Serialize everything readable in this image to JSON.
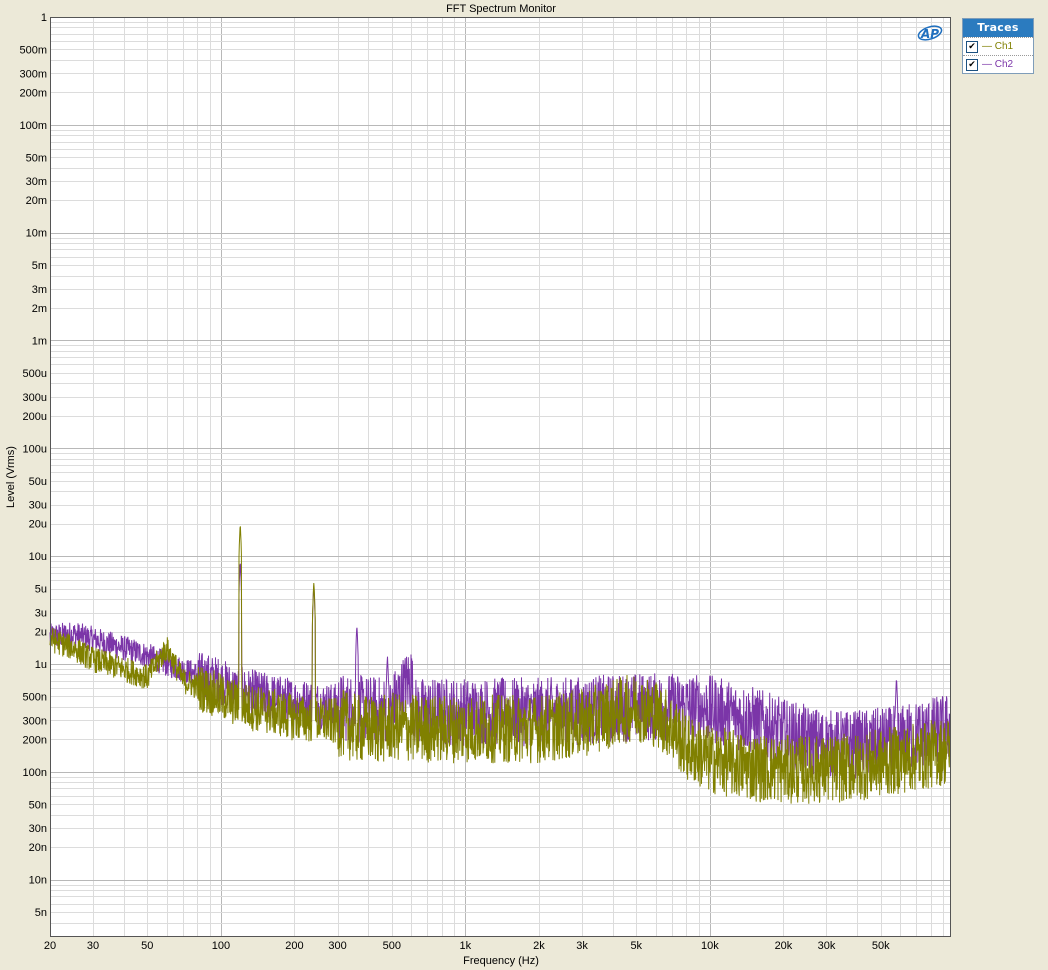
{
  "window": {
    "title": "FFT Spectrum Monitor"
  },
  "logo": {
    "text": "AP"
  },
  "traces_panel": {
    "header": "Traces",
    "items": [
      {
        "label": "— Ch1",
        "checked": true,
        "color": "#808000"
      },
      {
        "label": "— Ch2",
        "checked": true,
        "color": "#7b35a8"
      }
    ]
  },
  "chart_data": {
    "type": "line",
    "title": "FFT Spectrum Monitor",
    "xlabel": "Frequency (Hz)",
    "ylabel": "Level (Vrms)",
    "xscale": "log",
    "yscale": "log",
    "xlim": [
      20,
      96000
    ],
    "ylim": [
      3e-09,
      1
    ],
    "grid": true,
    "legend": "right panel",
    "x_ticks": [
      {
        "value": 20,
        "label": "20"
      },
      {
        "value": 30,
        "label": "30"
      },
      {
        "value": 50,
        "label": "50"
      },
      {
        "value": 100,
        "label": "100"
      },
      {
        "value": 200,
        "label": "200"
      },
      {
        "value": 300,
        "label": "300"
      },
      {
        "value": 500,
        "label": "500"
      },
      {
        "value": 1000,
        "label": "1k"
      },
      {
        "value": 2000,
        "label": "2k"
      },
      {
        "value": 3000,
        "label": "3k"
      },
      {
        "value": 5000,
        "label": "5k"
      },
      {
        "value": 10000,
        "label": "10k"
      },
      {
        "value": 20000,
        "label": "20k"
      },
      {
        "value": 30000,
        "label": "30k"
      },
      {
        "value": 50000,
        "label": "50k"
      }
    ],
    "y_ticks": [
      {
        "value": 1,
        "label": "1"
      },
      {
        "value": 0.5,
        "label": "500m"
      },
      {
        "value": 0.3,
        "label": "300m"
      },
      {
        "value": 0.2,
        "label": "200m"
      },
      {
        "value": 0.1,
        "label": "100m"
      },
      {
        "value": 0.05,
        "label": "50m"
      },
      {
        "value": 0.03,
        "label": "30m"
      },
      {
        "value": 0.02,
        "label": "20m"
      },
      {
        "value": 0.01,
        "label": "10m"
      },
      {
        "value": 0.005,
        "label": "5m"
      },
      {
        "value": 0.003,
        "label": "3m"
      },
      {
        "value": 0.002,
        "label": "2m"
      },
      {
        "value": 0.001,
        "label": "1m"
      },
      {
        "value": 0.0005,
        "label": "500u"
      },
      {
        "value": 0.0003,
        "label": "300u"
      },
      {
        "value": 0.0002,
        "label": "200u"
      },
      {
        "value": 0.0001,
        "label": "100u"
      },
      {
        "value": 5e-05,
        "label": "50u"
      },
      {
        "value": 3e-05,
        "label": "30u"
      },
      {
        "value": 2e-05,
        "label": "20u"
      },
      {
        "value": 1e-05,
        "label": "10u"
      },
      {
        "value": 5e-06,
        "label": "5u"
      },
      {
        "value": 3e-06,
        "label": "3u"
      },
      {
        "value": 2e-06,
        "label": "2u"
      },
      {
        "value": 1e-06,
        "label": "1u"
      },
      {
        "value": 5e-07,
        "label": "500n"
      },
      {
        "value": 3e-07,
        "label": "300n"
      },
      {
        "value": 2e-07,
        "label": "200n"
      },
      {
        "value": 1e-07,
        "label": "100n"
      },
      {
        "value": 5e-08,
        "label": "50n"
      },
      {
        "value": 3e-08,
        "label": "30n"
      },
      {
        "value": 2e-08,
        "label": "20n"
      },
      {
        "value": 1e-08,
        "label": "10n"
      },
      {
        "value": 5e-09,
        "label": "5n"
      }
    ],
    "series": [
      {
        "name": "Ch1",
        "color": "#808000",
        "points": [
          [
            20,
            1.7e-06
          ],
          [
            25,
            1.4e-06
          ],
          [
            30,
            1.1e-06
          ],
          [
            40,
            9e-07
          ],
          [
            50,
            7.5e-07
          ],
          [
            60,
            1.4e-06
          ],
          [
            70,
            7e-07
          ],
          [
            90,
            5.5e-07
          ],
          [
            110,
            4.5e-07
          ],
          [
            120,
            2e-05
          ],
          [
            130,
            4e-07
          ],
          [
            170,
            3.5e-07
          ],
          [
            200,
            3.2e-07
          ],
          [
            240,
            5.8e-06
          ],
          [
            250,
            3e-07
          ],
          [
            300,
            2.9e-07
          ],
          [
            360,
            2.5e-07
          ],
          [
            480,
            2.5e-07
          ],
          [
            500,
            2.6e-07
          ],
          [
            700,
            2.5e-07
          ],
          [
            1000,
            2.5e-07
          ],
          [
            2000,
            2.5e-07
          ],
          [
            3000,
            2.8e-07
          ],
          [
            4000,
            3.5e-07
          ],
          [
            5000,
            4e-07
          ],
          [
            6000,
            3.5e-07
          ],
          [
            7000,
            2.6e-07
          ],
          [
            8000,
            1.7e-07
          ],
          [
            10000,
            1.3e-07
          ],
          [
            15000,
            1.1e-07
          ],
          [
            20000,
            1.05e-07
          ],
          [
            30000,
            1.05e-07
          ],
          [
            40000,
            1.1e-07
          ],
          [
            50000,
            1.2e-07
          ],
          [
            60000,
            1.3e-07
          ],
          [
            75000,
            1.4e-07
          ],
          [
            96000,
            1.6e-07
          ]
        ]
      },
      {
        "name": "Ch2",
        "color": "#7b35a8",
        "points": [
          [
            20,
            1.8e-06
          ],
          [
            25,
            1.9e-06
          ],
          [
            30,
            1.7e-06
          ],
          [
            40,
            1.4e-06
          ],
          [
            50,
            1.2e-06
          ],
          [
            60,
            1e-06
          ],
          [
            80,
            8e-07
          ],
          [
            100,
            7e-07
          ],
          [
            110,
            6e-07
          ],
          [
            120,
            9e-06
          ],
          [
            130,
            5.5e-07
          ],
          [
            170,
            4.8e-07
          ],
          [
            200,
            4.5e-07
          ],
          [
            240,
            5.5e-06
          ],
          [
            250,
            4.2e-07
          ],
          [
            300,
            4e-07
          ],
          [
            360,
            2.3e-06
          ],
          [
            370,
            3.8e-07
          ],
          [
            480,
            1.2e-06
          ],
          [
            490,
            3.7e-07
          ],
          [
            600,
            7.5e-07
          ],
          [
            620,
            3.6e-07
          ],
          [
            1000,
            3.6e-07
          ],
          [
            2000,
            3.6e-07
          ],
          [
            3000,
            3.7e-07
          ],
          [
            5000,
            4e-07
          ],
          [
            8000,
            4e-07
          ],
          [
            10000,
            3.8e-07
          ],
          [
            15000,
            3e-07
          ],
          [
            20000,
            2.3e-07
          ],
          [
            30000,
            1.8e-07
          ],
          [
            40000,
            1.8e-07
          ],
          [
            50000,
            1.9e-07
          ],
          [
            58000,
            7.5e-07
          ],
          [
            60000,
            2e-07
          ],
          [
            75000,
            2.3e-07
          ],
          [
            96000,
            2.6e-07
          ]
        ]
      }
    ]
  }
}
